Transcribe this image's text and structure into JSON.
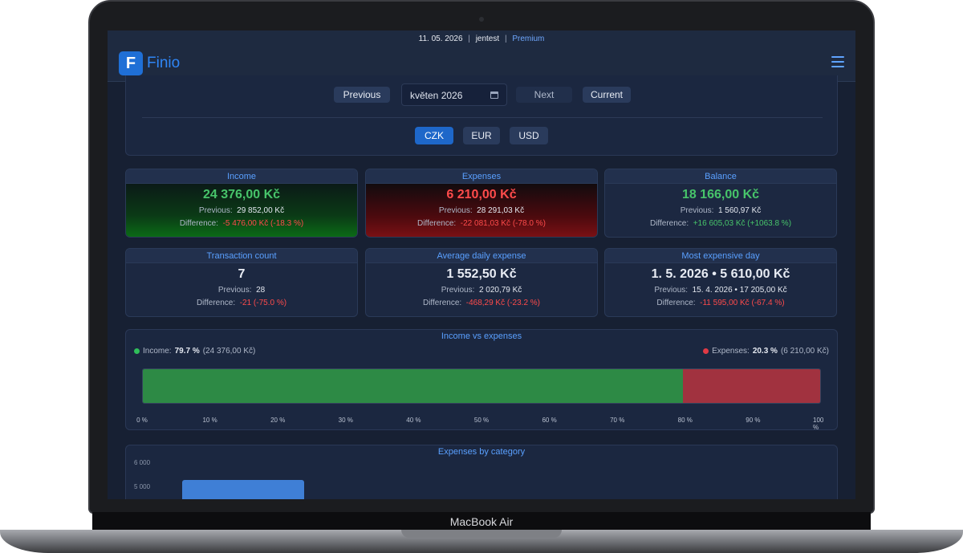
{
  "device": {
    "label": "MacBook Air"
  },
  "header": {
    "date": "11. 05. 2026",
    "separator": "|",
    "user": "jentest",
    "plan": "Premium",
    "logo_letter": "F",
    "app_name": "Finio"
  },
  "nav": {
    "previous": "Previous",
    "month_value": "květen 2026",
    "next": "Next",
    "current": "Current"
  },
  "currencies": {
    "czk": "CZK",
    "eur": "EUR",
    "usd": "USD",
    "selected": "CZK"
  },
  "cards": {
    "income": {
      "title": "Income",
      "value": "24 376,00 Kč",
      "prev_label": "Previous:",
      "prev_value": "29 852,00 Kč",
      "diff_label": "Difference:",
      "diff_value": "-5 476,00 Kč (-18.3 %)"
    },
    "expenses": {
      "title": "Expenses",
      "value": "6 210,00 Kč",
      "prev_label": "Previous:",
      "prev_value": "28 291,03 Kč",
      "diff_label": "Difference:",
      "diff_value": "-22 081,03 Kč (-78.0 %)"
    },
    "balance": {
      "title": "Balance",
      "value": "18 166,00 Kč",
      "prev_label": "Previous:",
      "prev_value": "1 560,97 Kč",
      "diff_label": "Difference:",
      "diff_value": "+16 605,03 Kč (+1063.8 %)"
    },
    "transactions": {
      "title": "Transaction count",
      "value": "7",
      "prev_label": "Previous:",
      "prev_value": "28",
      "diff_label": "Difference:",
      "diff_value": "-21 (-75.0 %)"
    },
    "avg_daily": {
      "title": "Average daily expense",
      "value": "1 552,50 Kč",
      "prev_label": "Previous:",
      "prev_value": "2 020,79 Kč",
      "diff_label": "Difference:",
      "diff_value": "-468,29 Kč (-23.2 %)"
    },
    "most_expensive": {
      "title": "Most expensive day",
      "value": "1. 5. 2026 • 5 610,00 Kč",
      "prev_label": "Previous:",
      "prev_value": "15. 4. 2026 • 17 205,00 Kč",
      "diff_label": "Difference:",
      "diff_value": "-11 595,00 Kč (-67.4 %)"
    }
  },
  "colors": {
    "income": "#2d8a45",
    "expenses": "#a1323f",
    "accent": "#5aa0ff",
    "positive": "#47c46a",
    "negative": "#ff4b4b"
  },
  "income_vs_expenses": {
    "title": "Income vs expenses",
    "income_label": "Income:",
    "income_pct": "79.7 %",
    "income_amount": "(24 376,00 Kč)",
    "expenses_label": "Expenses:",
    "expenses_pct": "20.3 %",
    "expenses_amount": "(6 210,00 Kč)",
    "income_share": 0.797,
    "ticks": [
      "0 %",
      "10 %",
      "20 %",
      "30 %",
      "40 %",
      "50 %",
      "60 %",
      "70 %",
      "80 %",
      "90 %",
      "100 %"
    ]
  },
  "expenses_by_category": {
    "title": "Expenses by category",
    "y_ticks": [
      "6 000",
      "5 000"
    ]
  }
}
